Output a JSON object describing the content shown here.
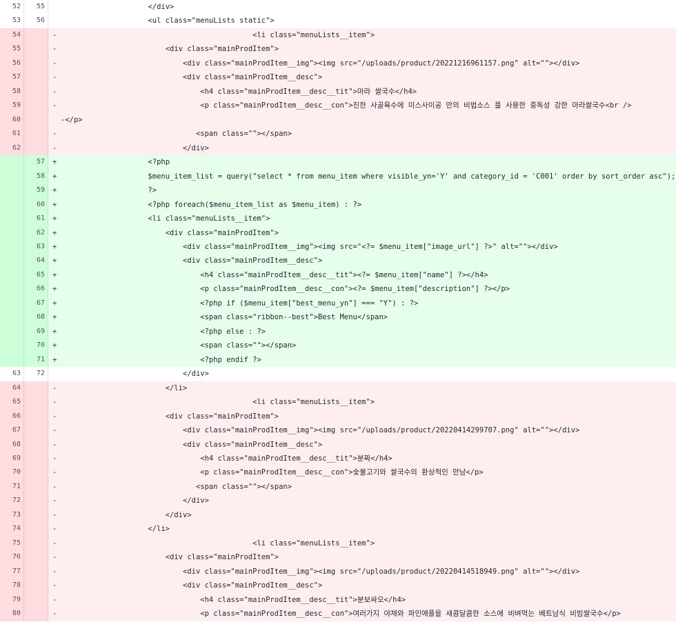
{
  "diff": {
    "rows": [
      {
        "type": "ctx",
        "old": "52",
        "new": "55",
        "sign": "",
        "text": "                    </div>"
      },
      {
        "type": "ctx",
        "old": "53",
        "new": "56",
        "sign": "",
        "text": "                    <ul class=\"menuLists static\">"
      },
      {
        "type": "del",
        "old": "54",
        "new": "",
        "sign": "-",
        "text": "                                            <li class=\"menuLists__item\">"
      },
      {
        "type": "del",
        "old": "55",
        "new": "",
        "sign": "-",
        "text": "                        <div class=\"mainProdItem\">"
      },
      {
        "type": "del",
        "old": "56",
        "new": "",
        "sign": "-",
        "text": "                            <div class=\"mainProdItem__img\"><img src=\"/uploads/product/20221216961157.png\" alt=\"\"></div>"
      },
      {
        "type": "del",
        "old": "57",
        "new": "",
        "sign": "-",
        "text": "                            <div class=\"mainProdItem__desc\">"
      },
      {
        "type": "del",
        "old": "58",
        "new": "",
        "sign": "-",
        "text": "                                <h4 class=\"mainProdItem__desc__tit\">마라 쌀국수</h4>"
      },
      {
        "type": "del",
        "old": "59",
        "new": "",
        "sign": "-",
        "text": "                                <p class=\"mainProdItem__desc__con\">진한 사골육수에 미스사이공 만의 비법소스 를 사용한 중독성 강한 마라쌀국수<br />"
      },
      {
        "type": "del",
        "old": "60",
        "new": "",
        "sign": "",
        "text": "-</p>"
      },
      {
        "type": "del",
        "old": "61",
        "new": "",
        "sign": "-",
        "text": "                               <span class=\"\"></span>"
      },
      {
        "type": "del",
        "old": "62",
        "new": "",
        "sign": "-",
        "text": "                            </div>"
      },
      {
        "type": "add",
        "old": "",
        "new": "57",
        "sign": "+",
        "text": "                    <?php"
      },
      {
        "type": "add",
        "old": "",
        "new": "58",
        "sign": "+",
        "text": "                    $menu_item_list = query(\"select * from menu_item where visible_yn='Y' and category_id = 'C001' order by sort_order asc\");"
      },
      {
        "type": "add",
        "old": "",
        "new": "59",
        "sign": "+",
        "text": "                    ?>"
      },
      {
        "type": "add",
        "old": "",
        "new": "60",
        "sign": "+",
        "text": "                    <?php foreach($menu_item_list as $menu_item) : ?>"
      },
      {
        "type": "add",
        "old": "",
        "new": "61",
        "sign": "+",
        "text": "                    <li class=\"menuLists__item\">"
      },
      {
        "type": "add",
        "old": "",
        "new": "62",
        "sign": "+",
        "text": "                        <div class=\"mainProdItem\">"
      },
      {
        "type": "add",
        "old": "",
        "new": "63",
        "sign": "+",
        "text": "                            <div class=\"mainProdItem__img\"><img src=\"<?= $menu_item[\"image_url\"] ?>\" alt=\"\"></div>"
      },
      {
        "type": "add",
        "old": "",
        "new": "64",
        "sign": "+",
        "text": "                            <div class=\"mainProdItem__desc\">"
      },
      {
        "type": "add",
        "old": "",
        "new": "65",
        "sign": "+",
        "text": "                                <h4 class=\"mainProdItem__desc__tit\"><?= $menu_item[\"name\"] ?></h4>"
      },
      {
        "type": "add",
        "old": "",
        "new": "66",
        "sign": "+",
        "text": "                                <p class=\"mainProdItem__desc__con\"><?= $menu_item[\"description\"] ?></p>"
      },
      {
        "type": "add",
        "old": "",
        "new": "67",
        "sign": "+",
        "text": "                                <?php if ($menu_item[\"best_menu_yn\"] === \"Y\") : ?>"
      },
      {
        "type": "add",
        "old": "",
        "new": "68",
        "sign": "+",
        "text": "                                <span class=\"ribbon--best\">Best Menu</span>"
      },
      {
        "type": "add",
        "old": "",
        "new": "69",
        "sign": "+",
        "text": "                                <?php else : ?>"
      },
      {
        "type": "add",
        "old": "",
        "new": "70",
        "sign": "+",
        "text": "                                <span class=\"\"></span>"
      },
      {
        "type": "add",
        "old": "",
        "new": "71",
        "sign": "+",
        "text": "                                <?php endif ?>"
      },
      {
        "type": "ctx",
        "old": "63",
        "new": "72",
        "sign": "",
        "text": "                            </div>"
      },
      {
        "type": "del",
        "old": "64",
        "new": "",
        "sign": "-",
        "text": "                        </li>"
      },
      {
        "type": "del",
        "old": "65",
        "new": "",
        "sign": "-",
        "text": "                                            <li class=\"menuLists__item\">"
      },
      {
        "type": "del",
        "old": "66",
        "new": "",
        "sign": "-",
        "text": "                        <div class=\"mainProdItem\">"
      },
      {
        "type": "del",
        "old": "67",
        "new": "",
        "sign": "-",
        "text": "                            <div class=\"mainProdItem__img\"><img src=\"/uploads/product/20220414299707.png\" alt=\"\"></div>"
      },
      {
        "type": "del",
        "old": "68",
        "new": "",
        "sign": "-",
        "text": "                            <div class=\"mainProdItem__desc\">"
      },
      {
        "type": "del",
        "old": "69",
        "new": "",
        "sign": "-",
        "text": "                                <h4 class=\"mainProdItem__desc__tit\">분짜</h4>"
      },
      {
        "type": "del",
        "old": "70",
        "new": "",
        "sign": "-",
        "text": "                                <p class=\"mainProdItem__desc__con\">숯불고기와 쌀국수의 환상적인 만남</p>"
      },
      {
        "type": "del",
        "old": "71",
        "new": "",
        "sign": "-",
        "text": "                               <span class=\"\"></span>"
      },
      {
        "type": "del",
        "old": "72",
        "new": "",
        "sign": "-",
        "text": "                            </div>"
      },
      {
        "type": "del",
        "old": "73",
        "new": "",
        "sign": "-",
        "text": "                        </div>"
      },
      {
        "type": "del",
        "old": "74",
        "new": "",
        "sign": "-",
        "text": "                    </li>"
      },
      {
        "type": "del",
        "old": "75",
        "new": "",
        "sign": "-",
        "text": "                                            <li class=\"menuLists__item\">"
      },
      {
        "type": "del",
        "old": "76",
        "new": "",
        "sign": "-",
        "text": "                        <div class=\"mainProdItem\">"
      },
      {
        "type": "del",
        "old": "77",
        "new": "",
        "sign": "-",
        "text": "                            <div class=\"mainProdItem__img\"><img src=\"/uploads/product/20220414518949.png\" alt=\"\"></div>"
      },
      {
        "type": "del",
        "old": "78",
        "new": "",
        "sign": "-",
        "text": "                            <div class=\"mainProdItem__desc\">"
      },
      {
        "type": "del",
        "old": "79",
        "new": "",
        "sign": "-",
        "text": "                                <h4 class=\"mainProdItem__desc__tit\">분보싸오</h4>"
      },
      {
        "type": "del",
        "old": "80",
        "new": "",
        "sign": "-",
        "text": "                                <p class=\"mainProdItem__desc__con\">여러가지 야채와 파인애플을 새콤달콤한 소스에 비벼먹는 베트남식 비빔쌀국수</p>"
      }
    ]
  }
}
